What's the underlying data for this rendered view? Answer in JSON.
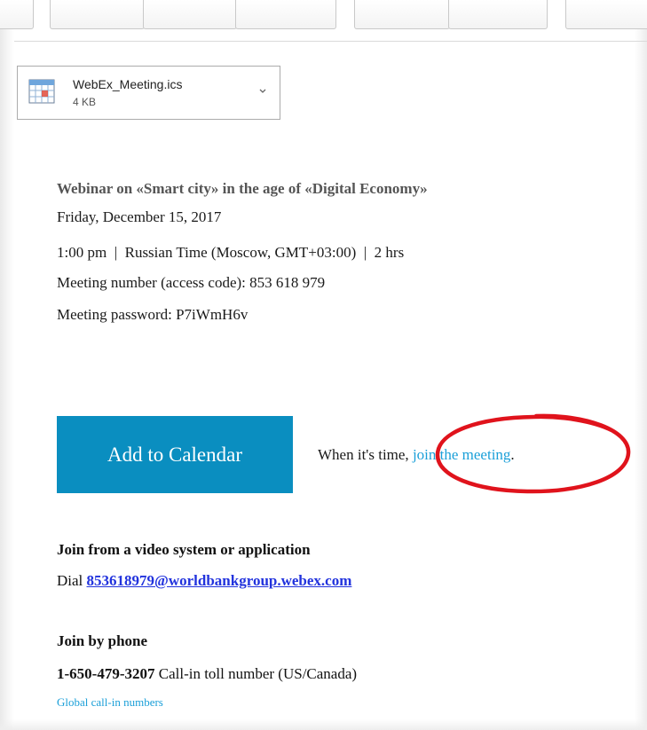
{
  "attachment": {
    "file_name": "WebEx_Meeting.ics",
    "file_size": "4 KB",
    "icon": "calendar-file-icon"
  },
  "meeting": {
    "title": "Webinar on «Smart city» in the age of «Digital Economy»",
    "date": "Friday, December 15, 2017",
    "time": "1:00 pm  |  Russian Time (Moscow, GMT+03:00)  |  2 hrs",
    "number": "Meeting number (access code): 853 618 979",
    "password": "Meeting password: P7iWmH6v"
  },
  "actions": {
    "add_to_calendar": "Add to Calendar",
    "join_prefix": "When it's time, ",
    "join_link": "join the meeting",
    "join_suffix": "."
  },
  "video": {
    "heading": "Join from a video system or application",
    "dial_prefix": "Dial ",
    "dial_address": "853618979@worldbankgroup.webex.com"
  },
  "phone": {
    "heading": "Join by phone",
    "number": "1-650-479-3207",
    "number_label": " Call-in toll number (US/Canada)",
    "global_link": "Global call-in numbers"
  },
  "colors": {
    "button": "#0a8ec0",
    "link": "#1a9fd8",
    "dial_link": "#2233dd",
    "annotation": "#e0131c"
  }
}
